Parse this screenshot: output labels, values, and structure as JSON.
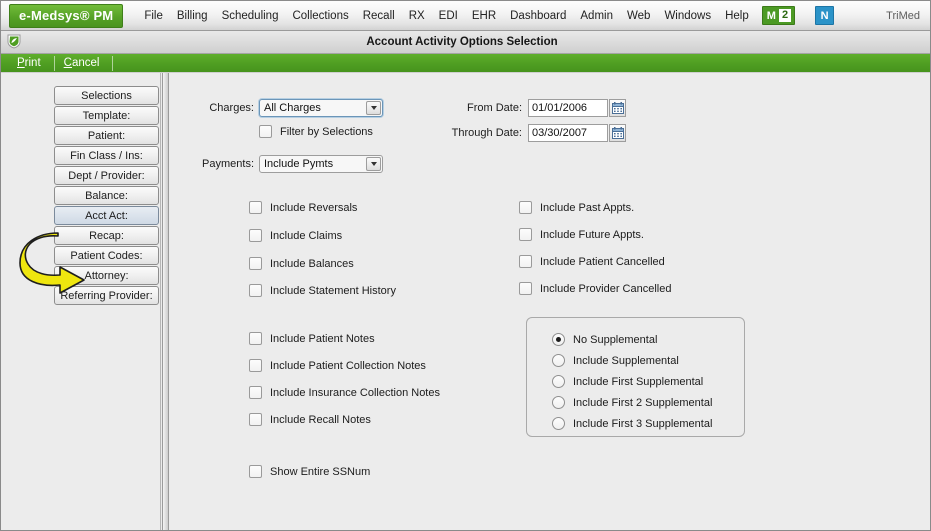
{
  "menubar": {
    "brand": "e-Medsys® PM",
    "items": [
      "File",
      "Billing",
      "Scheduling",
      "Collections",
      "Recall",
      "RX",
      "EDI",
      "EHR",
      "Dashboard",
      "Admin",
      "Web",
      "Windows",
      "Help"
    ],
    "badge_m_letter": "M",
    "badge_m_count": "2",
    "badge_n": "N",
    "right_label": "TriMed",
    "brand_color": "#4f9e22",
    "badge_n_color": "#2b93c8"
  },
  "titlebar": {
    "title": "Account Activity Options Selection",
    "logo_icon": "shield-leaf-icon"
  },
  "actionbar": {
    "print": "Print",
    "print_mnemonic": "P",
    "print_rest": "rint",
    "cancel": "Cancel",
    "cancel_mnemonic": "C",
    "cancel_rest": "ancel"
  },
  "sidebar": {
    "items": [
      {
        "label": "Selections",
        "active": false
      },
      {
        "label": "Template:",
        "active": false
      },
      {
        "label": "Patient:",
        "active": false
      },
      {
        "label": "Fin Class / Ins:",
        "active": false
      },
      {
        "label": "Dept / Provider:",
        "active": false
      },
      {
        "label": "Balance:",
        "active": false
      },
      {
        "label": "Acct Act:",
        "active": true
      },
      {
        "label": "Recap:",
        "active": false
      },
      {
        "label": "Patient Codes:",
        "active": false
      },
      {
        "label": "Attorney:",
        "active": false
      },
      {
        "label": "Referring Provider:",
        "active": false
      }
    ],
    "annotation": {
      "type": "curved-arrow",
      "color": "#f2e617",
      "points_to": "Acct Act:"
    }
  },
  "form": {
    "charges_label": "Charges:",
    "charges_value": "All Charges",
    "filter_by_selections": "Filter by Selections",
    "filter_by_selections_checked": false,
    "payments_label": "Payments:",
    "payments_value": "Include Pymts",
    "from_date_label": "From Date:",
    "from_date_value": "01/01/2006",
    "through_date_label": "Through Date:",
    "through_date_value": "03/30/2007",
    "calendar_icon": "calendar-icon"
  },
  "checkboxes_left": [
    {
      "label": "Include Reversals",
      "checked": false
    },
    {
      "label": "Include Claims",
      "checked": false
    },
    {
      "label": "Include Balances",
      "checked": false
    },
    {
      "label": "Include Statement History",
      "checked": false
    }
  ],
  "checkboxes_right": [
    {
      "label": "Include Past Appts.",
      "checked": false
    },
    {
      "label": "Include Future Appts.",
      "checked": false
    },
    {
      "label": "Include Patient Cancelled",
      "checked": false
    },
    {
      "label": "Include Provider Cancelled",
      "checked": false
    }
  ],
  "checkboxes_notes": [
    {
      "label": "Include Patient Notes",
      "checked": false
    },
    {
      "label": "Include Patient Collection Notes",
      "checked": false
    },
    {
      "label": "Include Insurance Collection Notes",
      "checked": false
    },
    {
      "label": "Include Recall Notes",
      "checked": false
    }
  ],
  "checkbox_ssnum": {
    "label": "Show Entire SSNum",
    "checked": false
  },
  "supplemental_options": [
    {
      "label": "No Supplemental",
      "selected": true
    },
    {
      "label": "Include Supplemental",
      "selected": false
    },
    {
      "label": "Include First Supplemental",
      "selected": false
    },
    {
      "label": "Include First 2 Supplemental",
      "selected": false
    },
    {
      "label": "Include First 3 Supplemental",
      "selected": false
    }
  ]
}
